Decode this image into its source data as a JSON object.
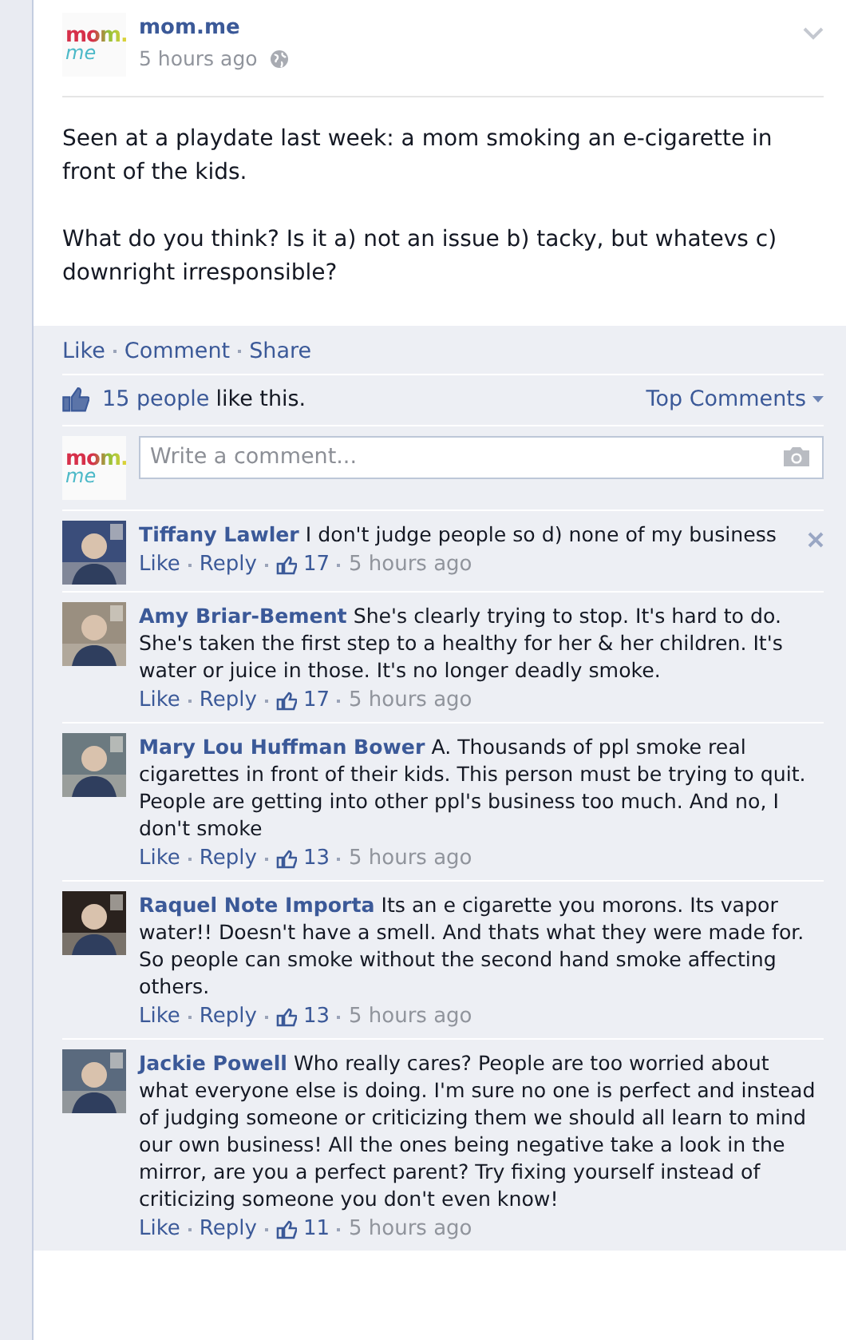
{
  "post": {
    "logo": {
      "line_1": "mom.",
      "line_2": "me"
    },
    "author": "mom.me",
    "time": "5 hours ago",
    "paragraphs": [
      "Seen at a playdate last week: a mom smoking an e-cigarette in front of the kids.",
      "What do you think? Is it a) not an issue b) tacky, but whatevs c) downright irresponsible?"
    ]
  },
  "actions": [
    "Like",
    "Comment",
    "Share"
  ],
  "likes": {
    "text": "15 people",
    "suffix": "like this."
  },
  "sort": {
    "label": "Top Comments"
  },
  "composer": {
    "logo": {
      "line_1": "mom.",
      "line_2": "me"
    },
    "placeholder": "Write a comment..."
  },
  "comments": [
    {
      "name": "Tiffany Lawler",
      "text": "I don't judge people so d) none of my business",
      "like": "Like",
      "reply": "Reply",
      "likes": "17",
      "time": "5 hours ago",
      "removable": true
    },
    {
      "name": "Amy Briar-Bement",
      "text": "She's clearly trying to stop. It's hard to do. She's taken the first step to a healthy for her & her children. It's water or juice in those. It's no longer deadly smoke.",
      "like": "Like",
      "reply": "Reply",
      "likes": "17",
      "time": "5 hours ago",
      "removable": false
    },
    {
      "name": "Mary Lou Huffman Bower",
      "text": "A. Thousands of ppl smoke real cigarettes in front of their kids. This person must be trying to quit. People are getting into other ppl's business too much. And no, I don't smoke",
      "like": "Like",
      "reply": "Reply",
      "likes": "13",
      "time": "5 hours ago",
      "removable": false
    },
    {
      "name": "Raquel Note Importa",
      "text": "Its an e cigarette you morons. Its vapor water!! Doesn't have a smell. And thats what they were made for. So people can smoke without the second hand smoke affecting others.",
      "like": "Like",
      "reply": "Reply",
      "likes": "13",
      "time": "5 hours ago",
      "removable": false
    },
    {
      "name": "Jackie Powell",
      "text": "Who really cares? People are too worried about what everyone else is doing. I'm sure no one is perfect and instead of judging someone or criticizing them we should all learn to mind our own business! All the ones being negative take a look in the mirror, are you a perfect parent? Try fixing yourself instead of criticizing someone you don't even know!",
      "like": "Like",
      "reply": "Reply",
      "likes": "11",
      "time": "5 hours ago",
      "removable": false
    }
  ]
}
